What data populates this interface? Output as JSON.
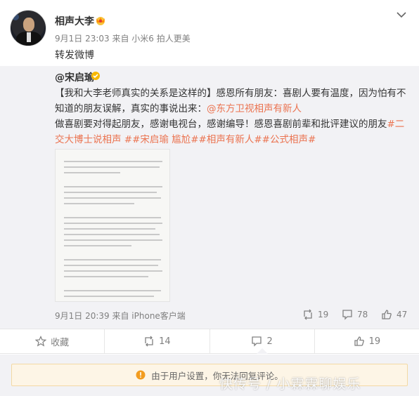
{
  "post": {
    "author": "相声大李",
    "meta": "9月1日 23:03 来自 小米6 拍人更美",
    "text": "转发微博"
  },
  "retweet": {
    "author": "@宋启瑜",
    "text_part1": "【我和大李老师真实的关系是这样的】感恩所有朋友：喜剧人要有温度，因为怕有不知道的朋友误解，真实的事说出来：",
    "mention": "@东方卫视相声有新人",
    "text_part2": "做喜剧要对得起朋友，感谢电视台，感谢编导！感恩喜剧前辈和批评建议的朋友",
    "hashtags": "#二交大博士说相声 ##宋启瑜 尴尬##相声有新人##公式相声#",
    "meta": "9月1日 20:39 来自 iPhone客户端",
    "actions": {
      "repost_count": "19",
      "comment_count": "78",
      "like_count": "47"
    }
  },
  "toolbar": {
    "favorite_label": "收藏",
    "repost_count": "14",
    "comment_count": "2",
    "like_count": "19"
  },
  "notice": {
    "text": "由于用户设置，你无法回复评论。"
  },
  "watermark": {
    "text": "快传号 / 小霖霖聊娱乐"
  },
  "icons": {
    "chevron": "chevron-down-icon",
    "vip": "vip-crown-icon",
    "verified": "verified-badge-icon",
    "favorite": "star-icon",
    "repost": "repost-icon",
    "comment": "comment-icon",
    "like": "thumbs-up-icon",
    "warning": "warning-icon"
  },
  "colors": {
    "link": "#eb7350",
    "muted": "#808080",
    "retweet_bg": "#f2f2f5",
    "notice_bg": "#fdf5e6"
  }
}
